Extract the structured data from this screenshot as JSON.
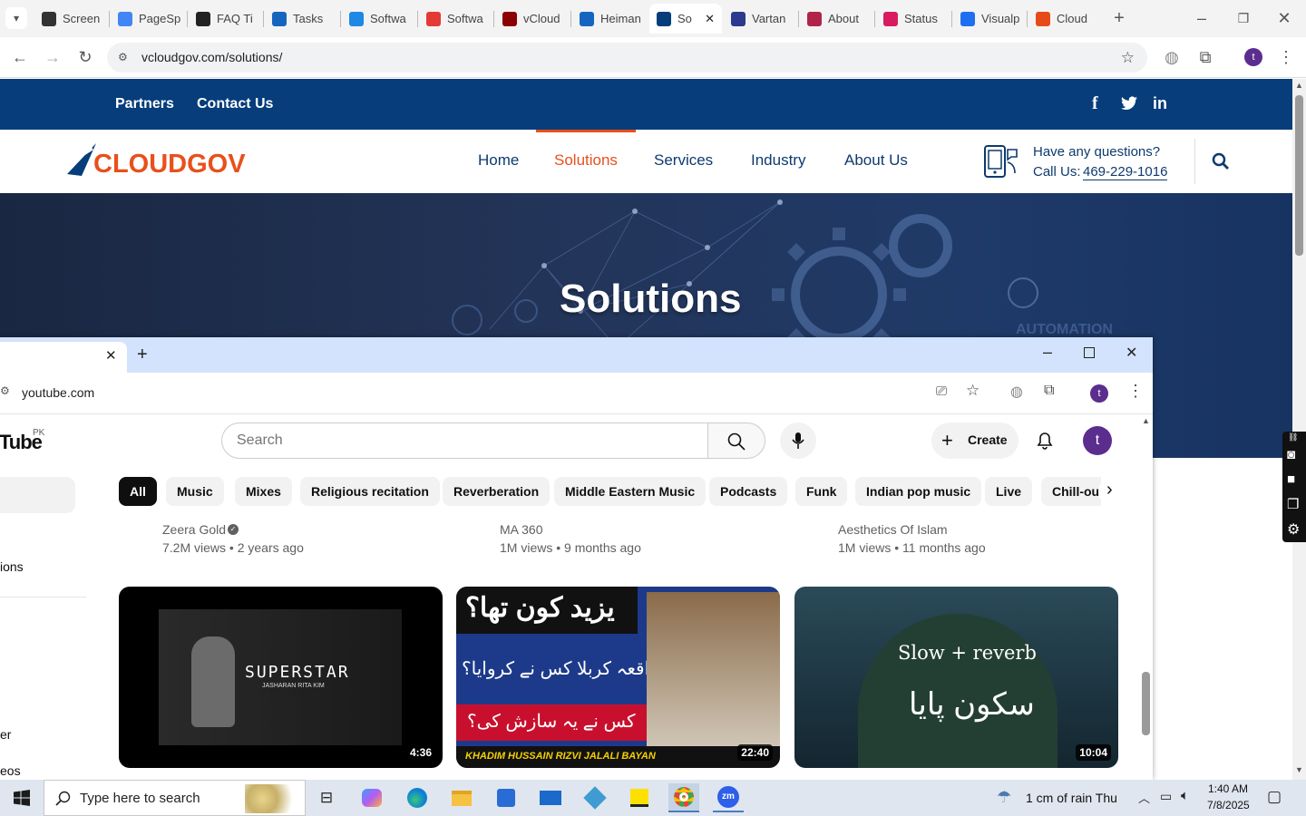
{
  "back_browser": {
    "tabs": [
      {
        "label": "Screen",
        "icon": "globe-icon",
        "color": "#333333"
      },
      {
        "label": "PageSp",
        "icon": "pagespeed-icon",
        "color": "#4285f4"
      },
      {
        "label": "FAQ Ti",
        "icon": "faq-icon",
        "color": "#222222"
      },
      {
        "label": "Tasks",
        "icon": "tasks-icon",
        "color": "#1565c0"
      },
      {
        "label": "Softwa",
        "icon": "softwa-icon",
        "color": "#1e88e5"
      },
      {
        "label": "Softwa",
        "icon": "softwa-red-icon",
        "color": "#e53935"
      },
      {
        "label": "vCloud",
        "icon": "vcloud-icon",
        "color": "#8b0000"
      },
      {
        "label": "Heiman",
        "icon": "heiman-icon",
        "color": "#1565c0"
      },
      {
        "label": "So",
        "icon": "cloudgov-icon",
        "color": "#063d7a"
      },
      {
        "label": "Vartan",
        "icon": "vartan-icon",
        "color": "#2b3a8c"
      },
      {
        "label": "About",
        "icon": "about-icon",
        "color": "#b0244a"
      },
      {
        "label": "Status",
        "icon": "status-icon",
        "color": "#d81b60"
      },
      {
        "label": "Visualp",
        "icon": "visualp-icon",
        "color": "#1e6ff0"
      },
      {
        "label": "Cloud",
        "icon": "cloud-icon",
        "color": "#e64a19"
      }
    ],
    "url": "vcloudgov.com/solutions/",
    "profile_initial": "t"
  },
  "site": {
    "top_links": [
      "Partners",
      "Contact Us"
    ],
    "logo_text": "CLOUDGOV",
    "nav": [
      "Home",
      "Solutions",
      "Services",
      "Industry",
      "About Us"
    ],
    "active_nav": "Solutions",
    "question": "Have any questions?",
    "call_label": "Call Us:",
    "phone": "469-229-1016",
    "hero_title": "Solutions",
    "hero_overlay": "AUTOMATION",
    "accent": "#e8501c",
    "brand": "#063d7a"
  },
  "yt_browser": {
    "url": "youtube.com",
    "logo_suffix": "Tube",
    "region": "PK",
    "search_placeholder": "Search",
    "create_label": "Create",
    "profile_initial": "t",
    "chips": [
      "All",
      "Music",
      "Mixes",
      "Religious recitation",
      "Reverberation",
      "Middle Eastern Music",
      "Podcasts",
      "Funk",
      "Indian pop music",
      "Live",
      "Chill-out"
    ],
    "sidebar_fragments": [
      "ions",
      "er",
      "eos"
    ],
    "prev_row": [
      {
        "channel": "Zeera Gold",
        "stats": "7.2M views • 2 years ago",
        "verified": true
      },
      {
        "channel": "MA 360",
        "stats": "1M views • 9 months ago",
        "verified": false
      },
      {
        "channel": "Aesthetics Of Islam",
        "stats": "1M views • 11 months ago",
        "verified": false
      }
    ],
    "videos": [
      {
        "duration": "4:36",
        "thumb_text": "SUPERSTAR",
        "thumb_sub": "JASHARAN RITA KIM"
      },
      {
        "duration": "22:40",
        "thumb_text": "یزید کون تھا؟",
        "thumb_line2": "واقعہ کربلا کس نے کروایا؟",
        "thumb_line3": "کس نے یہ سازش کی؟",
        "thumb_footer": "KHADIM HUSSAIN RIZVI JALALI BAYAN"
      },
      {
        "duration": "10:04",
        "thumb_text": "Slow + reverb",
        "thumb_line2": "سکون پایا"
      }
    ]
  },
  "taskbar": {
    "search_placeholder": "Type here to search",
    "weather": "1 cm of rain Thu",
    "time": "1:40 AM",
    "date": "7/8/2025"
  }
}
